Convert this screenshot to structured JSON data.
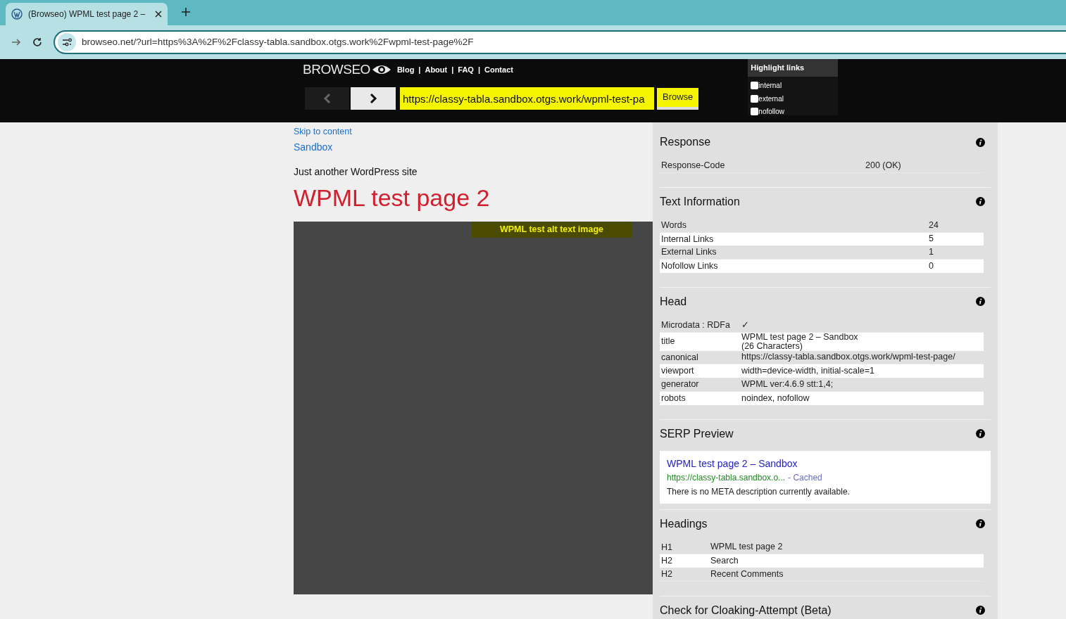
{
  "browser": {
    "tab_title": "(Browseo) WPML test page 2 –",
    "url": "browseo.net/?url=https%3A%2F%2Fclassy-tabla.sandbox.otgs.work%2Fwpml-test-page%2F"
  },
  "header": {
    "logo": "BROWSEO",
    "nav": [
      "Blog",
      "About",
      "FAQ",
      "Contact"
    ],
    "separator": "|",
    "url_value": "https://classy-tabla.sandbox.otgs.work/wpml-test-pa",
    "browse_button": "Browse",
    "highlight_links": {
      "title": "Highlight links",
      "options": [
        {
          "label": "internal",
          "checked": false
        },
        {
          "label": "external",
          "checked": false
        },
        {
          "label": "nofollow",
          "checked": false
        }
      ]
    }
  },
  "page": {
    "skip_link": "Skip to content",
    "site_link": "Sandbox",
    "tagline": "Just another WordPress site",
    "heading": "WPML test page 2",
    "image_alt": "WPML test alt text image"
  },
  "panels": [
    {
      "kind": "table",
      "title": "Response",
      "rows": [
        {
          "label": "Response-Code",
          "value": "200 (OK)"
        }
      ]
    },
    {
      "kind": "table",
      "title": "Text Information",
      "rows": [
        {
          "label": "Words",
          "value": "24"
        },
        {
          "label": "Internal Links",
          "value": "5"
        },
        {
          "label": "External Links",
          "value": "1"
        },
        {
          "label": "Nofollow Links",
          "value": "0"
        }
      ]
    },
    {
      "kind": "table",
      "title": "Head",
      "rows": [
        {
          "label": "Microdata : RDFa",
          "value": "✓"
        },
        {
          "label": "title",
          "value": "WPML test page 2 – Sandbox",
          "note": "(26 Characters)"
        },
        {
          "label": "canonical",
          "value": "https://classy-tabla.sandbox.otgs.work/wpml-test-page/"
        },
        {
          "label": "viewport",
          "value": "width=device-width, initial-scale=1"
        },
        {
          "label": "generator",
          "value": "WPML ver:4.6.9 stt:1,4;"
        },
        {
          "label": "robots",
          "value": "noindex, nofollow"
        }
      ]
    },
    {
      "kind": "serp",
      "title": "SERP Preview",
      "serp": {
        "title": "WPML test page 2 – Sandbox",
        "url": "https://classy-tabla.sandbox.o...",
        "cached": "- Cached",
        "description": "There is no META description currently available."
      }
    },
    {
      "kind": "table",
      "title": "Headings",
      "rows": [
        {
          "label": "H1",
          "value": "WPML test page 2"
        },
        {
          "label": "H2",
          "value": "Search"
        },
        {
          "label": "H2",
          "value": "Recent Comments"
        }
      ]
    },
    {
      "kind": "title",
      "title": "Check for Cloaking-Attempt (Beta)"
    }
  ]
}
